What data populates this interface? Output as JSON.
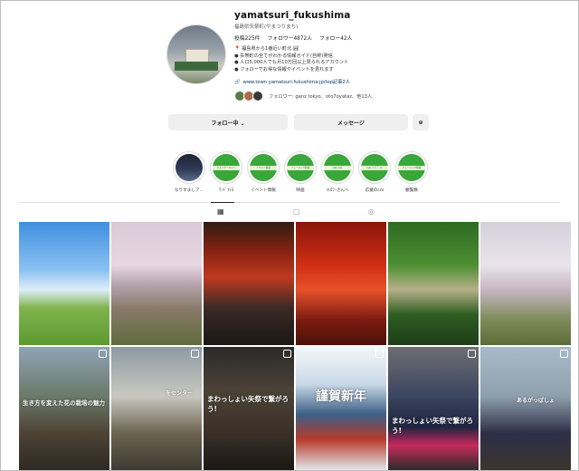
{
  "profile": {
    "username": "yamatsuri_fukushima",
    "subname": "福島県矢祭町(やまつりまち)",
    "stats": {
      "posts": "投稿225件",
      "followers": "フォロワー4872人",
      "following": "フォロー42人"
    },
    "bio": [
      "📍 福島県から1番近い町北 🏞",
      "● 矢祭町の全てがわかる情報ガイド(自称)発信",
      "● 人口5,000人でも月10万回以上見られるアカウント",
      "● フォローでお得な情報やイベントを見れます"
    ],
    "link": "www.town.yamatsuri.fukushima.jp/top記事2人",
    "followed_by": "フォロワー: ganz.tokyo、oto7oyataz、他13人"
  },
  "buttons": {
    "follow": "フォロー中 ⌄",
    "message": "メッセージ",
    "add": "⊕"
  },
  "highlights": [
    {
      "cover": "",
      "label": "なりすましア..."
    },
    {
      "cover": "ジェイナーマイン",
      "label": "ﾜﾝﾄﾞﾌｫﾛ"
    },
    {
      "cover": "イベント情報",
      "label": "イベント情報"
    },
    {
      "cover": "ミュージック特集",
      "label": "映画"
    },
    {
      "cover": "ﾌｫﾛﾜｰﾌｫﾛｰ",
      "label": "ﾌｫﾛﾜｰさんへ"
    },
    {
      "cover": "ﾁｮｺﾚｰﾄ ﾎﾞﾃﾞｨﾜﾝ",
      "label": "応援のcm"
    },
    {
      "cover": "ミュージック特集",
      "label": "観覧数"
    }
  ],
  "tabs": {
    "posts_icon": "grid-icon",
    "reels_icon": "reels-icon",
    "tagged_icon": "tagged-icon"
  },
  "grid_captions": {
    "p7": "生き方を変えた花の栽培の魅力",
    "p8": "をセンター",
    "p9": "まわっしょい矢祭で繋がろう!",
    "p10": "謹賀新年",
    "p11": "まわっしょい矢祭で繋がろう!",
    "p12": "あるがっぱしょ"
  },
  "colors": {
    "accent_link": "#00376b",
    "button_bg": "#efefef",
    "divider": "#dbdbdb"
  }
}
